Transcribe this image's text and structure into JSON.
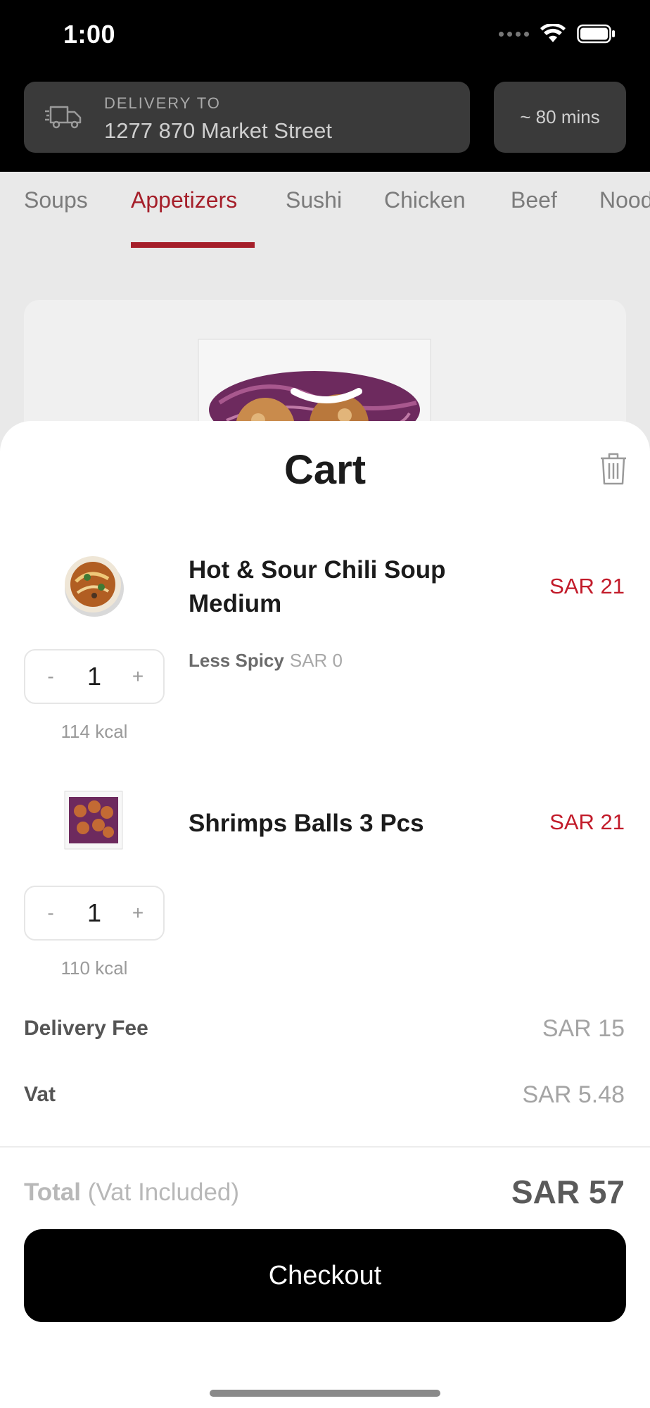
{
  "status_bar": {
    "time": "1:00"
  },
  "header": {
    "delivery_label": "DELIVERY TO",
    "delivery_address": "1277 870 Market Street",
    "eta": "~ 80 mins"
  },
  "categories": {
    "tabs": [
      "Soups",
      "Appetizers",
      "Sushi",
      "Chicken",
      "Beef",
      "Nood"
    ],
    "active": "Appetizers"
  },
  "cart": {
    "title": "Cart",
    "items": [
      {
        "name": "Hot & Sour Chili Soup Medium",
        "price": "SAR 21",
        "option": "Less Spicy",
        "option_price": "SAR 0",
        "quantity": "1",
        "kcal": "114 kcal"
      },
      {
        "name": "Shrimps Balls 3 Pcs",
        "price": "SAR 21",
        "quantity": "1",
        "kcal": "110 kcal"
      }
    ],
    "stepper": {
      "minus": "-",
      "plus": "+"
    },
    "delivery_fee_label": "Delivery Fee",
    "delivery_fee": "SAR 15",
    "vat_label": "Vat",
    "vat": "SAR 5.48",
    "total_label": "Total",
    "total_note": "(Vat Included)",
    "total": "SAR 57",
    "checkout_label": "Checkout"
  },
  "colors": {
    "accent": "#c21b2a",
    "tab_active": "#a51f2a",
    "button": "#000000"
  }
}
